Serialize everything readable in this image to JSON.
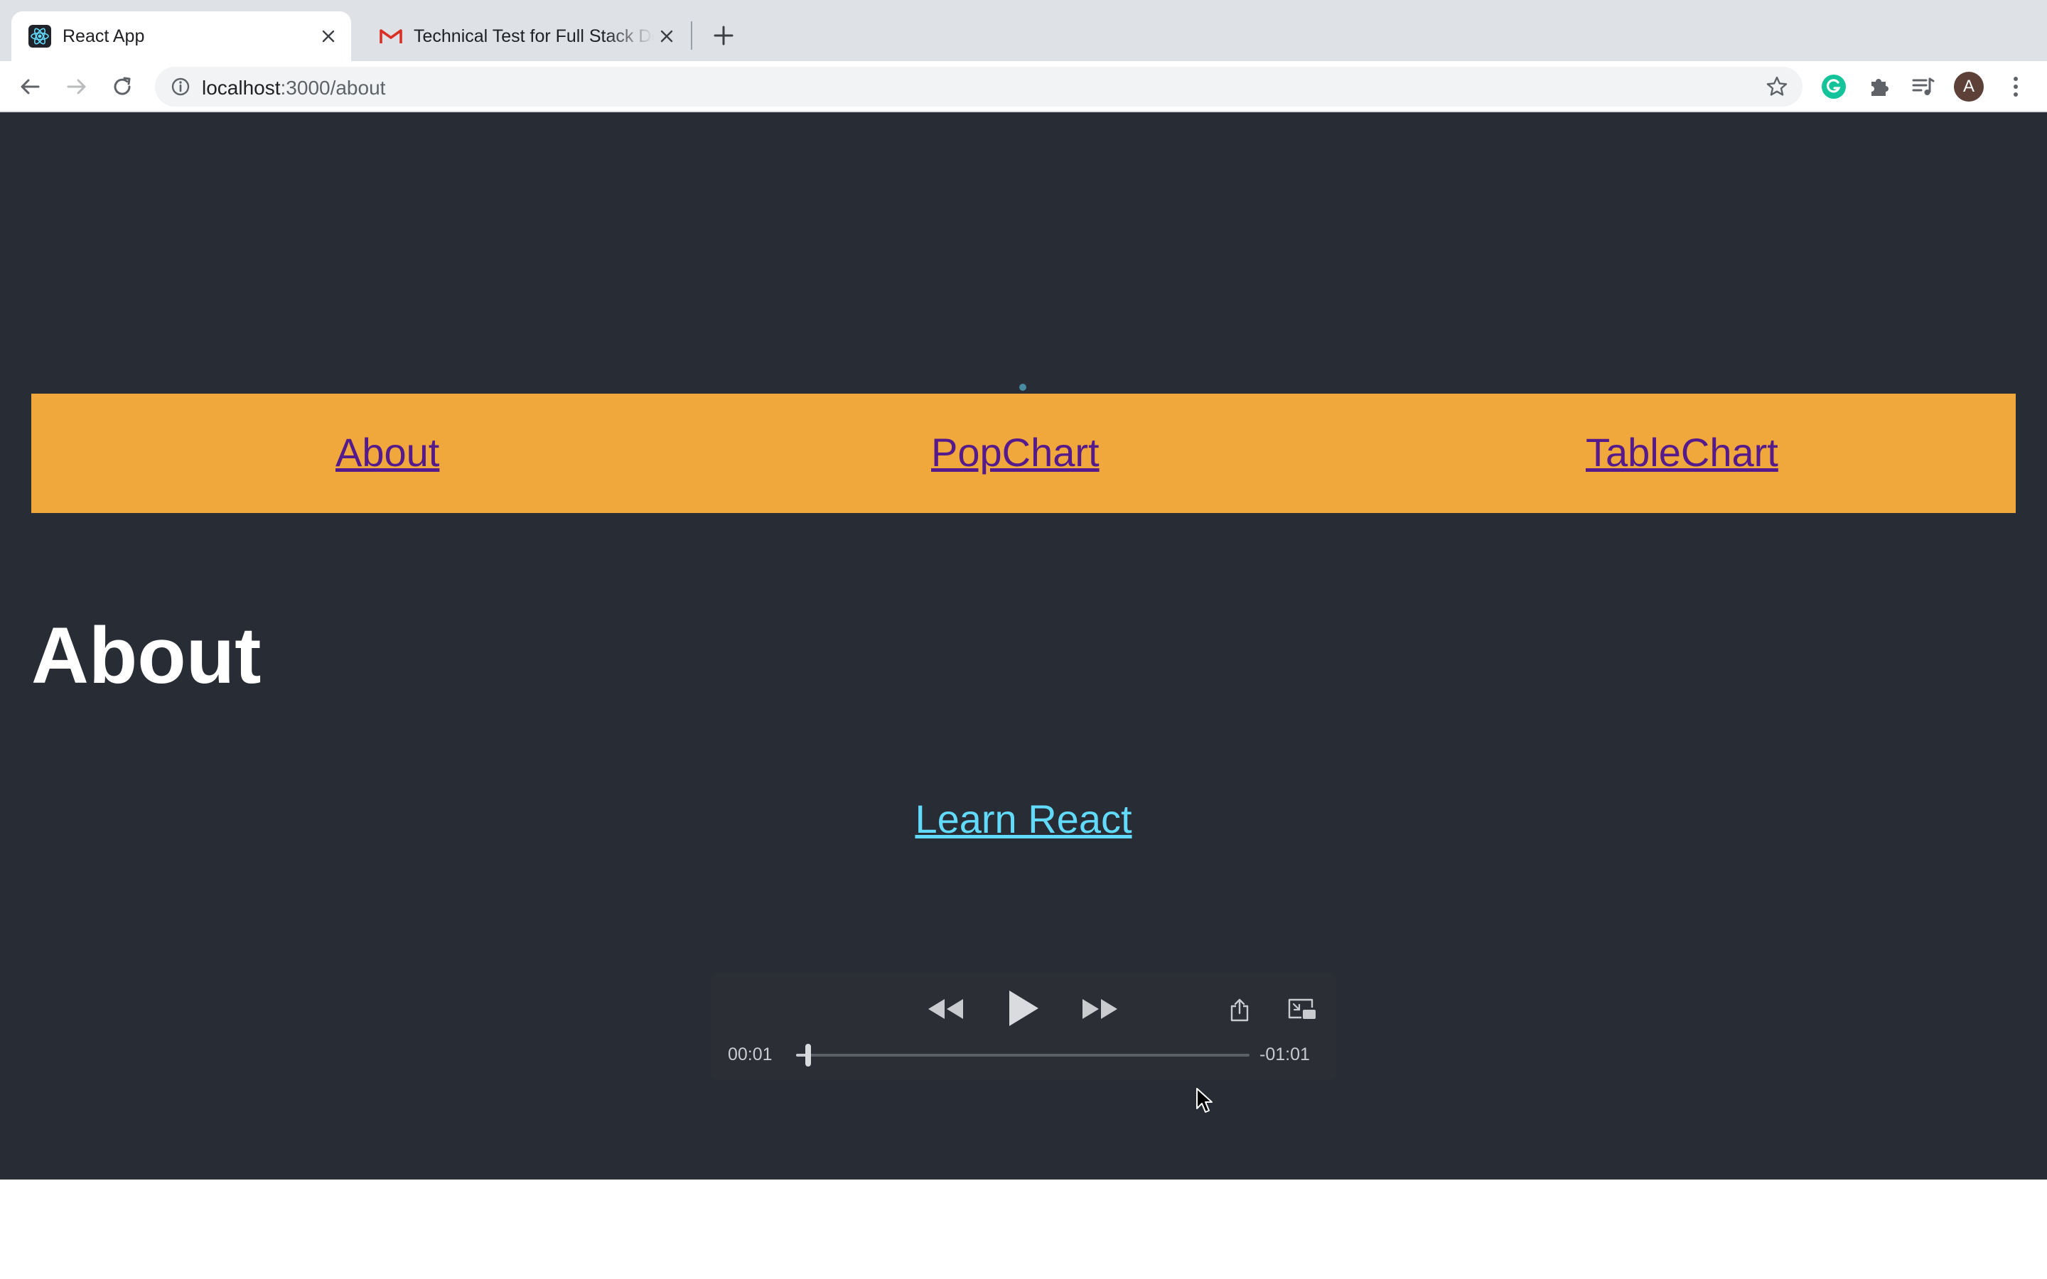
{
  "browser": {
    "tabs": [
      {
        "title": "React App",
        "icon": "react-logo-icon",
        "active": true
      },
      {
        "title": "Technical Test for Full Stack Developer",
        "icon": "gmail-icon",
        "active": false
      }
    ],
    "url": {
      "host": "localhost",
      "path": ":3000/about"
    },
    "avatar_initial": "A"
  },
  "nav": {
    "links": [
      "About",
      "PopChart",
      "TableChart"
    ],
    "background": "#f0a73b",
    "link_color": "#551a8b"
  },
  "page": {
    "heading": "About",
    "learn_link": "Learn React",
    "background": "#282c34",
    "link_color": "#61dafb"
  },
  "player": {
    "elapsed": "00:01",
    "remaining": "-01:01",
    "progress": 0.027
  }
}
